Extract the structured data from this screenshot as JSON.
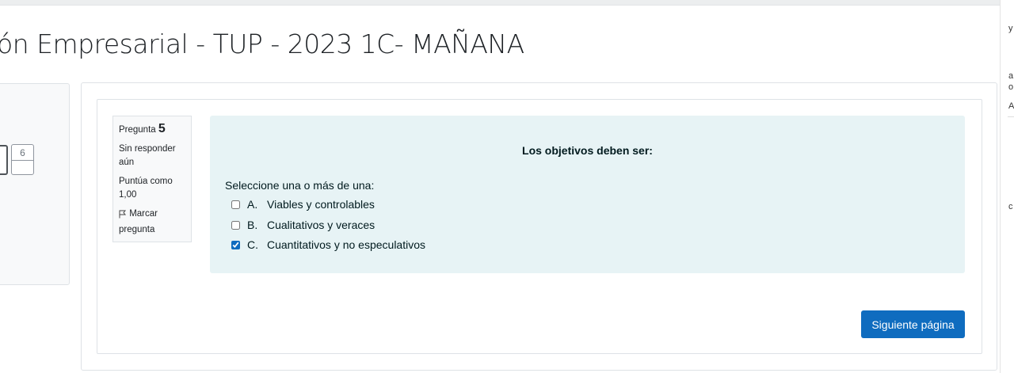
{
  "page": {
    "title": "ón Empresarial - TUP - 2023 1C- MAÑANA"
  },
  "navigation": {
    "visible_question_button": "6"
  },
  "question_info": {
    "label": "Pregunta",
    "number": "5",
    "state": "Sin responder aún",
    "grade": "Puntúa como 1,00",
    "flag_label": "Marcar pregunta",
    "flag_icon": "flag-outline-icon"
  },
  "question": {
    "text": "Los objetivos deben ser:",
    "prompt": "Seleccione una o más de una:",
    "answers": [
      {
        "letter": "A.",
        "text": "Viables y controlables",
        "checked": false
      },
      {
        "letter": "B.",
        "text": "Cualitativos y veraces",
        "checked": false
      },
      {
        "letter": "C.",
        "text": "Cuantitativos y no especulativos",
        "checked": true
      }
    ]
  },
  "actions": {
    "next_page_label": "Siguiente página"
  },
  "colors": {
    "accent": "#0f6cbf",
    "question_bg": "#e7f3f5",
    "info_bg": "#f8f9fa"
  },
  "right_edge_fragments": [
    "y",
    "a",
    "o",
    "A",
    "c"
  ]
}
